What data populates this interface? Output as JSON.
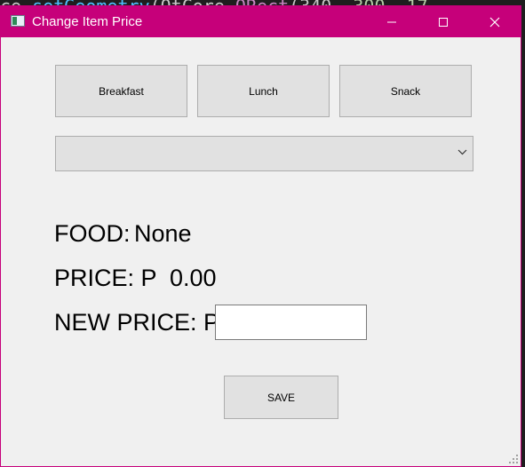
{
  "window": {
    "title": "Change Item Price"
  },
  "background_code": {
    "part1": "ce ",
    "fn": "setGeometry",
    "part2": "(QtCore.",
    "cls": "QRect",
    "part3": "(340, ",
    "num": "300, 17"
  },
  "buttons": {
    "breakfast": "Breakfast",
    "lunch": "Lunch",
    "snack": "Snack",
    "save": "SAVE"
  },
  "combo": {
    "selected": ""
  },
  "labels": {
    "food_label": "FOOD:",
    "food_value": "None",
    "price_label": "PRICE: P",
    "price_value": "0.00",
    "new_price_label": "NEW PRICE: P"
  },
  "new_price_input": {
    "value": ""
  },
  "icons": {
    "app": "app-window-icon",
    "minimize": "minimize-icon",
    "maximize": "maximize-icon",
    "close": "close-icon",
    "dropdown": "chevron-down-icon",
    "resize": "resize-grip-icon"
  },
  "colors": {
    "titlebar": "#c6007a",
    "window_bg": "#f0f0f0",
    "button_bg": "#e1e1e1"
  }
}
